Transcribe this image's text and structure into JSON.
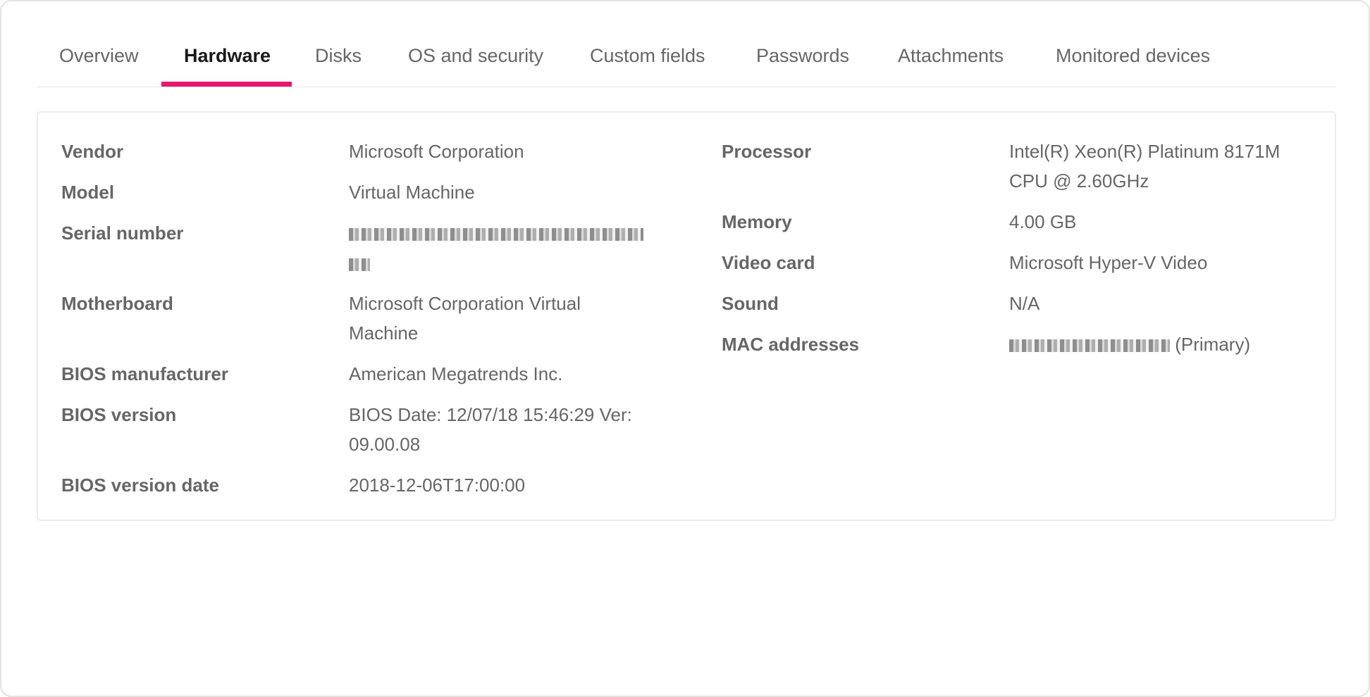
{
  "tabs": [
    {
      "label": "Overview",
      "active": false
    },
    {
      "label": "Hardware",
      "active": true
    },
    {
      "label": "Disks",
      "active": false
    },
    {
      "label": "OS and security",
      "active": false
    },
    {
      "label": "Custom fields",
      "active": false
    },
    {
      "label": "Passwords",
      "active": false
    },
    {
      "label": "Attachments",
      "active": false
    },
    {
      "label": "Monitored devices",
      "active": false
    }
  ],
  "accent_color": "#e8176b",
  "hardware": {
    "left": [
      {
        "label": "Vendor",
        "value": "Microsoft Corporation"
      },
      {
        "label": "Model",
        "value": "Virtual Machine"
      },
      {
        "label": "Serial number",
        "value": "",
        "redacted": true
      },
      {
        "label": "Motherboard",
        "value": "Microsoft Corporation Virtual Machine"
      },
      {
        "label": "BIOS manufacturer",
        "value": "American Megatrends Inc."
      },
      {
        "label": "BIOS version",
        "value": "BIOS Date: 12/07/18 15:46:29 Ver: 09.00.08"
      },
      {
        "label": "BIOS version date",
        "value": "2018-12-06T17:00:00"
      }
    ],
    "right": [
      {
        "label": "Processor",
        "value": "Intel(R) Xeon(R) Platinum 8171M CPU @ 2.60GHz"
      },
      {
        "label": "Memory",
        "value": "4.00 GB"
      },
      {
        "label": "Video card",
        "value": "Microsoft Hyper-V Video"
      },
      {
        "label": "Sound",
        "value": "N/A"
      },
      {
        "label": "MAC addresses",
        "value": "(Primary)",
        "redacted_prefix": true
      }
    ]
  }
}
